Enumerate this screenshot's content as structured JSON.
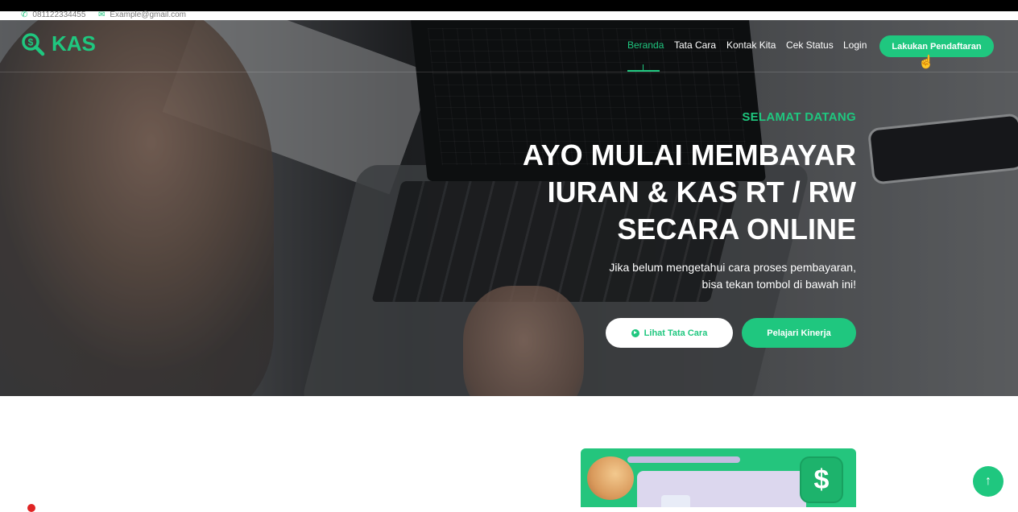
{
  "topbar": {
    "phone": "081122334455",
    "email": "Example@gmail.com",
    "phone_icon": "phone-icon",
    "email_icon": "envelope-icon"
  },
  "brand": {
    "name": "KAS",
    "icon": "search-dollar-icon"
  },
  "nav": {
    "items": [
      {
        "label": "Beranda",
        "active": true
      },
      {
        "label": "Tata Cara",
        "active": false
      },
      {
        "label": "Kontak Kita",
        "active": false
      },
      {
        "label": "Cek Status",
        "active": false
      },
      {
        "label": "Login",
        "active": false
      }
    ],
    "cta_label": "Lakukan Pendaftaran"
  },
  "hero": {
    "welcome": "SELAMAT DATANG",
    "headline_lines": [
      "AYO MULAI MEMBAYAR",
      "IURAN & KAS RT / RW",
      "SECARA ONLINE"
    ],
    "subtitle_lines": [
      "Jika belum mengetahui cara proses pembayaran,",
      "bisa tekan tombol di bawah ini!"
    ],
    "btn_primary": "Lihat Tata Cara",
    "btn_secondary": "Pelajari Kinerja"
  },
  "promo": {
    "dollar_symbol": "$"
  },
  "back_to_top_icon": "arrow-up-icon",
  "colors": {
    "accent": "#1fc77f"
  }
}
